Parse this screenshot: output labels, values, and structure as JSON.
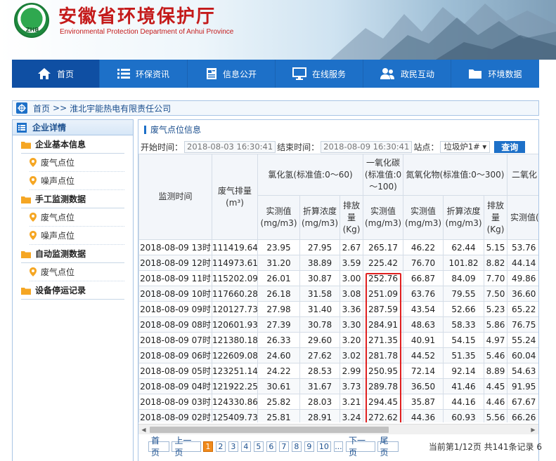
{
  "header": {
    "title": "安徽省环境保护厅",
    "subtitle": "Environmental Protection Department of Anhui Province",
    "logo_text": "ZHB"
  },
  "nav": [
    {
      "label": "首页",
      "icon": "home-icon"
    },
    {
      "label": "环保资讯",
      "icon": "list-icon"
    },
    {
      "label": "信息公开",
      "icon": "document-icon"
    },
    {
      "label": "在线服务",
      "icon": "monitor-icon"
    },
    {
      "label": "政民互动",
      "icon": "people-icon"
    },
    {
      "label": "环境数据",
      "icon": "folder-icon"
    }
  ],
  "breadcrumb": {
    "home": "首页",
    "separator": ">>",
    "current": "淮北宇能热电有限责任公司"
  },
  "sidebar": {
    "title": "企业详情",
    "groups": [
      {
        "label": "企业基本信息",
        "items": [
          "废气点位",
          "噪声点位"
        ]
      },
      {
        "label": "手工监测数据",
        "items": [
          "废气点位",
          "噪声点位"
        ]
      },
      {
        "label": "自动监测数据",
        "items": [
          "废气点位"
        ]
      },
      {
        "label": "设备停运记录",
        "items": []
      }
    ]
  },
  "main": {
    "section_title": "废气点位信息",
    "filter": {
      "start_label": "开始时间：",
      "start_value": "2018-08-03 16:30:41",
      "end_label": "结束时间：",
      "end_value": "2018-08-09 16:30:41",
      "site_label": "站点：",
      "site_value": "垃圾炉1# ▾",
      "query_button": "查询"
    },
    "table": {
      "col_time": "监测时间",
      "col_flow": "废气排量(m³)",
      "group_hcl": "氯化氢(标准值:0～60)",
      "group_co": "一氧化碳(标准值:0～100)",
      "group_nox": "氮氧化物(标准值:0～300)",
      "group_so2": "二氧化",
      "sub_measured": "实测值(mg/m3)",
      "sub_converted": "折算浓度(mg/m3)",
      "sub_emission": "排放量(Kg)",
      "rows": [
        [
          "2018-08-09 13时",
          "111419.64",
          "23.95",
          "27.95",
          "2.67",
          "265.17",
          "46.22",
          "62.44",
          "5.15",
          "53.76"
        ],
        [
          "2018-08-09 12时",
          "114973.61",
          "31.20",
          "38.89",
          "3.59",
          "225.42",
          "76.70",
          "101.82",
          "8.82",
          "44.14"
        ],
        [
          "2018-08-09 11时",
          "115202.09",
          "26.01",
          "30.87",
          "3.00",
          "252.76",
          "66.87",
          "84.09",
          "7.70",
          "49.86"
        ],
        [
          "2018-08-09 10时",
          "117660.28",
          "26.18",
          "31.58",
          "3.08",
          "251.09",
          "63.76",
          "79.55",
          "7.50",
          "36.60"
        ],
        [
          "2018-08-09 09时",
          "120127.73",
          "27.98",
          "31.40",
          "3.36",
          "287.59",
          "43.54",
          "52.66",
          "5.23",
          "65.22"
        ],
        [
          "2018-08-09 08时",
          "120601.93",
          "27.39",
          "30.78",
          "3.30",
          "284.91",
          "48.63",
          "58.33",
          "5.86",
          "76.75"
        ],
        [
          "2018-08-09 07时",
          "121380.18",
          "26.33",
          "29.60",
          "3.20",
          "271.35",
          "40.91",
          "54.15",
          "4.97",
          "55.24"
        ],
        [
          "2018-08-09 06时",
          "122609.08",
          "24.60",
          "27.62",
          "3.02",
          "281.78",
          "44.52",
          "51.35",
          "5.46",
          "60.04"
        ],
        [
          "2018-08-09 05时",
          "123251.14",
          "24.22",
          "28.53",
          "2.99",
          "250.95",
          "72.14",
          "92.14",
          "8.89",
          "54.63"
        ],
        [
          "2018-08-09 04时",
          "121922.25",
          "30.61",
          "31.67",
          "3.73",
          "289.78",
          "36.50",
          "41.46",
          "4.45",
          "91.95"
        ],
        [
          "2018-08-09 03时",
          "124330.86",
          "25.82",
          "28.03",
          "3.21",
          "294.45",
          "35.87",
          "44.16",
          "4.46",
          "67.67"
        ],
        [
          "2018-08-09 02时",
          "125409.73",
          "25.81",
          "28.91",
          "3.24",
          "272.62",
          "44.36",
          "60.93",
          "5.56",
          "66.26"
        ]
      ]
    },
    "pager": {
      "first": "首页",
      "prev": "上一页",
      "pages": [
        "1",
        "2",
        "3",
        "4",
        "5",
        "6",
        "7",
        "8",
        "9",
        "10"
      ],
      "ellipsis": "...",
      "next": "下一页",
      "last": "尾页",
      "info": "当前第1/12页 共141条记录 6"
    }
  }
}
